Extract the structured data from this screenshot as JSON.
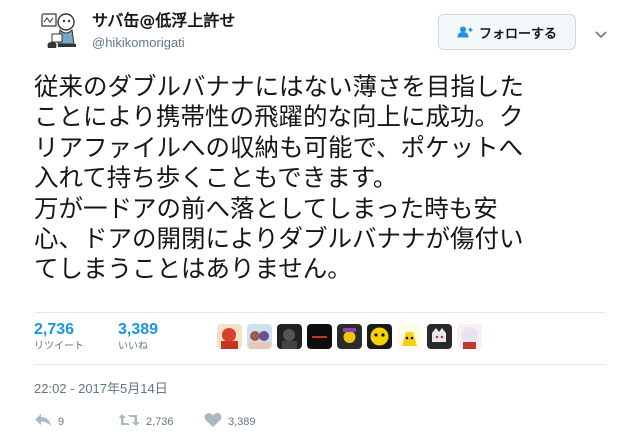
{
  "user": {
    "display_name": "サバ缶@低浮上許せ",
    "handle": "@hikikomorigati"
  },
  "follow_button": {
    "label": "フォローする",
    "icon": "follow-user-icon"
  },
  "tweet": {
    "lines": [
      "従来のダブルバナナにはない薄さを目指した",
      "ことにより携帯性の飛躍的な向上に成功。ク",
      "リアファイルへの収納も可能で、ポケットへ",
      "入れて持ち歩くこともできます。",
      "万が一ドアの前へ落としてしまった時も安",
      "心、ドアの開閉によりダブルバナナが傷付い",
      "てしまうことはありません。"
    ],
    "timestamp": "22:02 - 2017年5月14日"
  },
  "stats": {
    "retweets": {
      "count": "2,736",
      "label": "リツイート"
    },
    "likes": {
      "count": "3,389",
      "label": "いいね"
    }
  },
  "actions": {
    "reply": {
      "icon": "reply-icon",
      "count": "9"
    },
    "retweet": {
      "icon": "retweet-icon",
      "count": "2,736"
    },
    "like": {
      "icon": "heart-icon",
      "count": "3,389"
    }
  },
  "colors": {
    "accent": "#1b95e0",
    "text": "#14171a",
    "muted": "#657786",
    "action_icon": "#aab8c2",
    "divider": "#e1e8ed"
  }
}
